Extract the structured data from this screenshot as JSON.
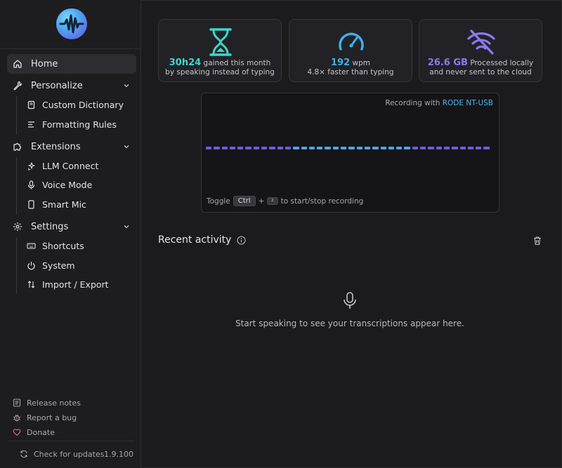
{
  "sidebar": {
    "nav": [
      {
        "label": "Home",
        "icon": "home-icon",
        "active": true
      },
      {
        "label": "Personalize",
        "icon": "wrench-icon",
        "expandable": true
      },
      {
        "label": "Extensions",
        "icon": "puzzle-icon",
        "expandable": true
      },
      {
        "label": "Settings",
        "icon": "gear-icon",
        "expandable": true
      }
    ],
    "personalize_items": [
      {
        "label": "Custom Dictionary",
        "icon": "book-icon"
      },
      {
        "label": "Formatting Rules",
        "icon": "text-lines-icon"
      }
    ],
    "extensions_items": [
      {
        "label": "LLM Connect",
        "icon": "sparkles-icon"
      },
      {
        "label": "Voice Mode",
        "icon": "mic-icon"
      },
      {
        "label": "Smart Mic",
        "icon": "phone-icon"
      }
    ],
    "settings_items": [
      {
        "label": "Shortcuts",
        "icon": "keyboard-icon"
      },
      {
        "label": "System",
        "icon": "power-icon"
      },
      {
        "label": "Import / Export",
        "icon": "arrows-updown-icon"
      }
    ],
    "footer": {
      "release_notes": "Release notes",
      "report_bug": "Report a bug",
      "donate": "Donate",
      "check_updates": "Check for updates",
      "version": "1.9.100"
    }
  },
  "stats": [
    {
      "value": "30h24",
      "suffix": "gained this month",
      "line2": "by speaking instead of typing",
      "icon": "hourglass-icon",
      "color": "#3fd6c8"
    },
    {
      "value": "192",
      "suffix": "wpm",
      "line2": "4.8× faster than typing",
      "icon": "speedometer-icon",
      "color": "#3fb0ea"
    },
    {
      "value": "26.6 GB",
      "suffix": "Processed locally",
      "line2": "and never sent to the cloud",
      "icon": "wifi-off-icon",
      "color": "#8e78f0"
    }
  ],
  "recording": {
    "label_prefix": "Recording with",
    "device": "RODE NT-USB",
    "toggle_prefix": "Toggle",
    "key1": "Ctrl",
    "plus": "+",
    "key2": "²",
    "toggle_suffix": "to start/stop recording",
    "colors": {
      "accent_purple": "#6e5ae6",
      "accent_blue": "#4aa6e8"
    }
  },
  "recent": {
    "title": "Recent activity",
    "empty_text": "Start speaking to see your transcriptions appear here."
  }
}
